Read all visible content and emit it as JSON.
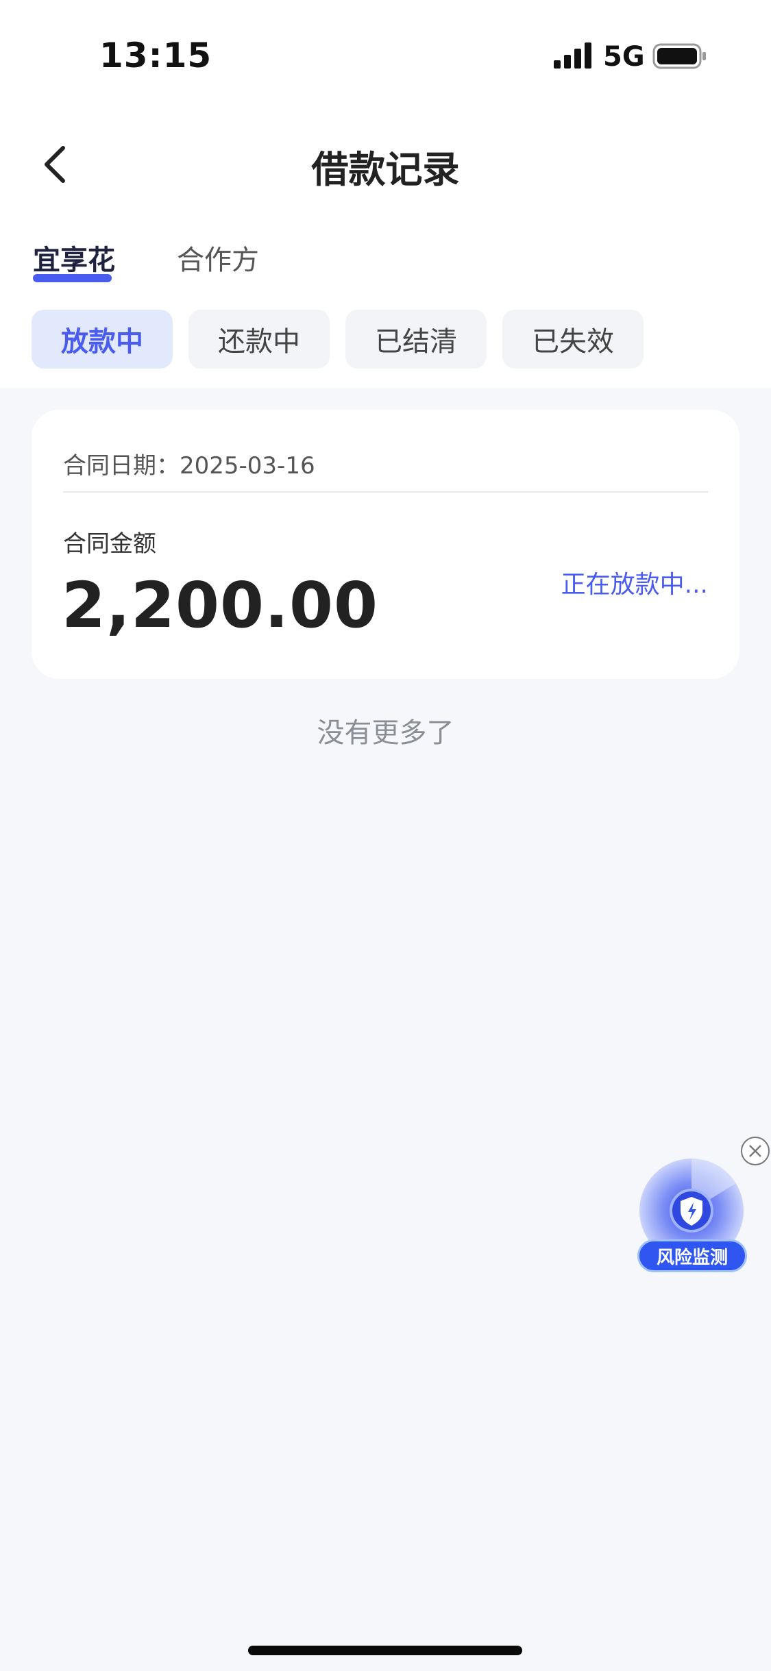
{
  "status_bar": {
    "time": "13:15",
    "network": "5G"
  },
  "nav": {
    "title": "借款记录"
  },
  "provider_tabs": [
    {
      "label": "宜享花",
      "active": true
    },
    {
      "label": "合作方",
      "active": false
    }
  ],
  "status_chips": [
    {
      "label": "放款中",
      "active": true
    },
    {
      "label": "还款中",
      "active": false
    },
    {
      "label": "已结清",
      "active": false
    },
    {
      "label": "已失效",
      "active": false
    }
  ],
  "loan_card": {
    "date_text": "合同日期：2025-03-16",
    "amount_label": "合同金额",
    "amount": "2,200.00",
    "status": "正在放款中..."
  },
  "list_footer": "没有更多了",
  "risk_widget": {
    "label": "风险监测"
  },
  "colors": {
    "accent": "#4a5cf0",
    "page_bg": "#f5f7fb",
    "chip_active_bg": "#e2e9fd",
    "chip_bg": "#f3f4f7"
  }
}
